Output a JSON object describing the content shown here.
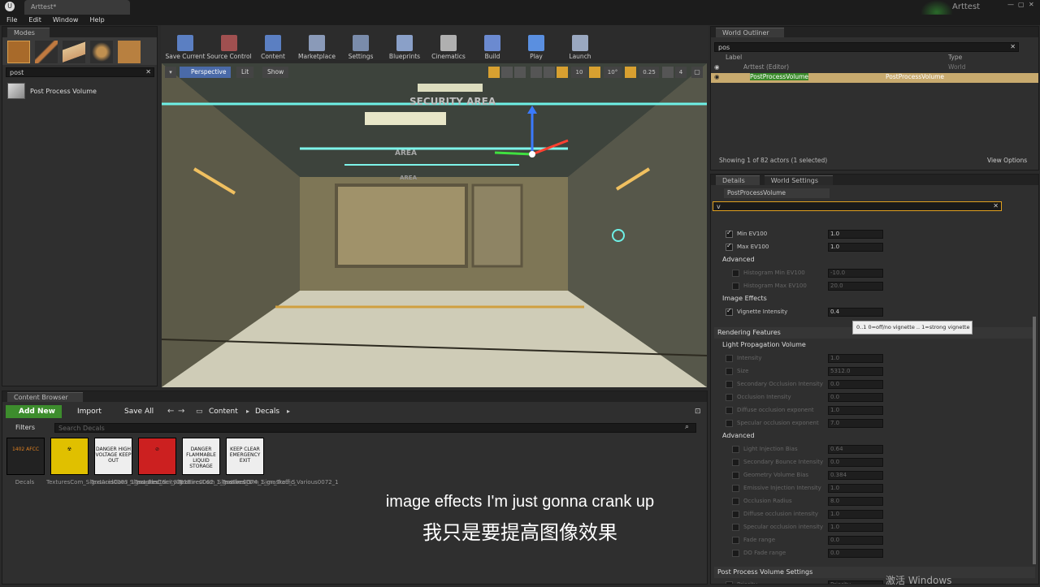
{
  "window": {
    "title": "Arttest*",
    "project": "Arttest"
  },
  "menu": [
    "File",
    "Edit",
    "Window",
    "Help"
  ],
  "modes": {
    "tab": "Modes",
    "search": "post",
    "result": "Post Process Volume"
  },
  "toolbar": [
    {
      "label": "Save Current",
      "color": "#5b7fc2"
    },
    {
      "label": "Source Control",
      "color": "#a05050"
    },
    {
      "label": "Content",
      "color": "#5b7fc2"
    },
    {
      "label": "Marketplace",
      "color": "#8a9ab8"
    },
    {
      "label": "Settings",
      "color": "#7a8cab"
    },
    {
      "label": "Blueprints",
      "color": "#8aa0c8"
    },
    {
      "label": "Cinematics",
      "color": "#b0b0b0"
    },
    {
      "label": "Build",
      "color": "#6b8ad0"
    },
    {
      "label": "Play",
      "color": "#5a8fe0"
    },
    {
      "label": "Launch",
      "color": "#9aa8c0"
    }
  ],
  "viewport": {
    "perspective": "Perspective",
    "lit": "Lit",
    "show": "Show",
    "grid": "10",
    "angle": "10°",
    "scale": "0.25",
    "cam": "4",
    "signs": [
      "SECURITY AREA",
      "AREA",
      "AREA"
    ]
  },
  "outliner": {
    "tab": "World Outliner",
    "search": "pos",
    "col_label": "Label",
    "col_type": "Type",
    "rows": [
      {
        "label": "Arttest (Editor)",
        "type": "World"
      },
      {
        "label": "PostProcessVolume",
        "type": "PostProcessVolume"
      }
    ],
    "status": "Showing 1 of 82 actors (1 selected)",
    "view_options": "View Options"
  },
  "details": {
    "tab1": "Details",
    "tab2": "World Settings",
    "actor": "PostProcessVolume",
    "search": "v",
    "rows": [
      {
        "label": "Min EV100",
        "value": "1.0",
        "on": true,
        "dim": false,
        "indent": 1
      },
      {
        "label": "Max EV100",
        "value": "1.0",
        "on": true,
        "dim": false,
        "indent": 1
      },
      {
        "section": "Advanced"
      },
      {
        "label": "Histogram Min EV100",
        "value": "-10.0",
        "on": false,
        "dim": true,
        "indent": 2
      },
      {
        "label": "Histogram Max EV100",
        "value": "20.0",
        "on": false,
        "dim": true,
        "indent": 2
      },
      {
        "section": "Image Effects"
      },
      {
        "label": "Vignette Intensity",
        "value": "0.4",
        "on": true,
        "dim": false,
        "indent": 1
      }
    ],
    "tooltip": "0..1 0=off/no vignette .. 1=strong vignette",
    "rendering": "Rendering Features",
    "lpv": "Light Propagation Volume",
    "lpv_rows": [
      {
        "label": "Intensity",
        "value": "1.0"
      },
      {
        "label": "Size",
        "value": "5312.0"
      },
      {
        "label": "Secondary Occlusion Intensity",
        "value": "0.0"
      },
      {
        "label": "Occlusion Intensity",
        "value": "0.0"
      },
      {
        "label": "Diffuse occlusion exponent",
        "value": "1.0"
      },
      {
        "label": "Specular occlusion exponent",
        "value": "7.0"
      }
    ],
    "advanced2": "Advanced",
    "adv_rows": [
      {
        "label": "Light Injection Bias",
        "value": "0.64"
      },
      {
        "label": "Secondary Bounce Intensity",
        "value": "0.0"
      },
      {
        "label": "Geometry Volume Bias",
        "value": "0.384"
      },
      {
        "label": "Emissive Injection Intensity",
        "value": "1.0"
      },
      {
        "label": "Occlusion Radius",
        "value": "8.0"
      },
      {
        "label": "Diffuse occlusion intensity",
        "value": "1.0"
      },
      {
        "label": "Specular occlusion intensity",
        "value": "1.0"
      },
      {
        "label": "Fade range",
        "value": "0.0"
      },
      {
        "label": "DO Fade range",
        "value": "0.0"
      }
    ],
    "ppvs": "Post Process Volume Settings",
    "priority": "Priority"
  },
  "content": {
    "tab": "Content Browser",
    "add_new": "Add New",
    "import": "Import",
    "save_all": "Save All",
    "crumbs": [
      "Content",
      "Decals"
    ],
    "filters": "Filters",
    "search": "Search Decals",
    "assets": [
      {
        "name": "Decals",
        "sign": "1402 AFCC"
      },
      {
        "name": "TexturesCom_SignsAcid0003_1_masked_S",
        "sign": "☢"
      },
      {
        "name": "TexturesCom_Signs_Electricity0018",
        "sign": "DANGER HIGH VOLTAGE KEEP OUT"
      },
      {
        "name": "TexturesCom_SignsFire0062_1_masked_S",
        "sign": "⊘"
      },
      {
        "name": "TexturesCom_SignsFire0074_1_masked_S",
        "sign": "DANGER FLAMMABLE LIQUID STORAGE"
      },
      {
        "name": "TexturesCom_Sign_Traffic_Various0072_1",
        "sign": "KEEP CLEAR EMERGENCY EXIT"
      }
    ]
  },
  "subtitle": {
    "en": "image effects I'm just gonna crank up",
    "zh": "我只是要提高图像效果"
  },
  "watermark": "激活 Windows"
}
